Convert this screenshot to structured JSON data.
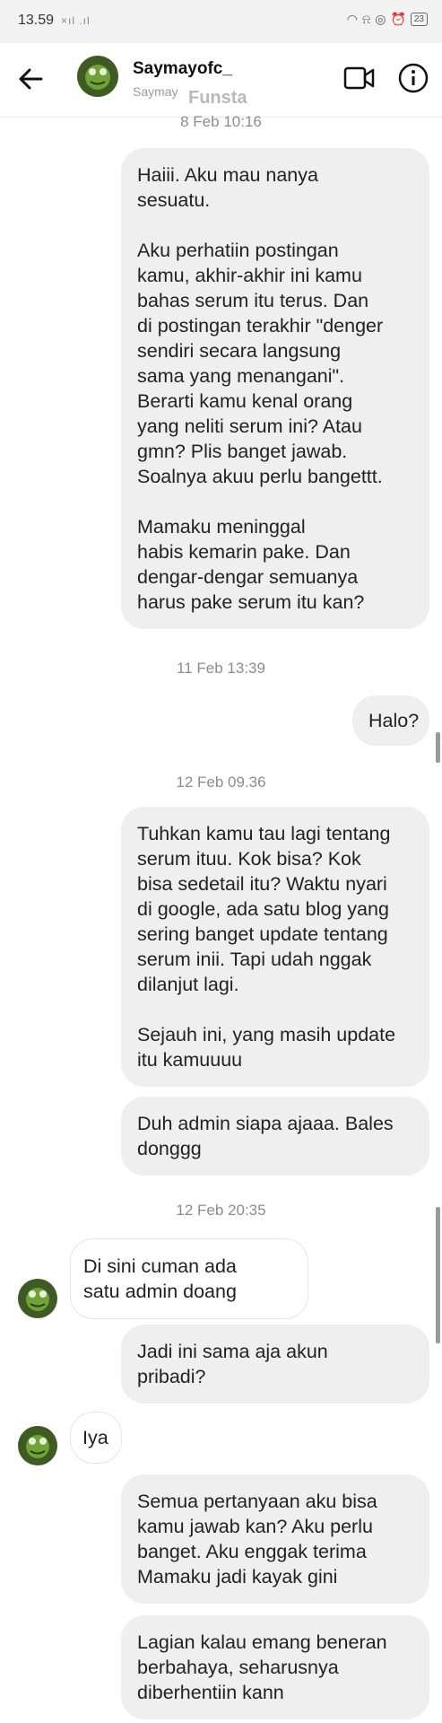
{
  "status_bar": {
    "time": "13.59",
    "left_icons": "×ıl .ıl",
    "battery": "23",
    "icons": [
      "wifi-icon",
      "mute-bell-icon",
      "data-saver-icon",
      "alarm-icon"
    ]
  },
  "header": {
    "name": "Saymayofc_",
    "subtitle": "Saymay",
    "subtitle_overlay": "Funsta",
    "icons": [
      "back-arrow-icon",
      "video-call-icon",
      "info-icon"
    ]
  },
  "chat": {
    "timestamps": [
      "8 Feb 10:16",
      "11 Feb 13:39",
      "12 Feb 09.36",
      "12 Feb 20:35"
    ],
    "messages": [
      {
        "dir": "out",
        "text": "Haiii. Aku mau nanya\nsesuatu.\n\nAku perhatiin postingan\nkamu, akhir-akhir ini kamu\nbahas serum itu terus. Dan\ndi postingan terakhir \"denger\nsendiri secara langsung\nsama yang menangani\".\nBerarti kamu kenal orang\nyang neliti serum ini? Atau\ngmn? Plis banget jawab.\nSoalnya akuu perlu bangettt.\n\nMamaku meninggal\nhabis kemarin pake. Dan\ndengar-dengar semuanya\nharus pake serum itu kan?"
      },
      {
        "dir": "out",
        "text": "Halo?"
      },
      {
        "dir": "out",
        "text": "Tuhkan kamu tau lagi tentang\nserum ituu. Kok bisa? Kok\nbisa sedetail itu? Waktu nyari\ndi google, ada satu blog yang\nsering banget update tentang\nserum inii. Tapi udah nggak\ndilanjut lagi.\n\nSejauh ini, yang masih update\nitu kamuuuu"
      },
      {
        "dir": "out",
        "text": "Duh admin siapa ajaaa. Bales\ndonggg"
      },
      {
        "dir": "in",
        "text": "Di sini cuman ada\nsatu admin doang"
      },
      {
        "dir": "out",
        "text": "Jadi ini sama aja akun\npribadi?"
      },
      {
        "dir": "in",
        "text": "Iya"
      },
      {
        "dir": "out",
        "text": "Semua pertanyaan aku bisa\nkamu jawab kan? Aku perlu\nbanget. Aku enggak terima\nMamaku jadi kayak gini"
      },
      {
        "dir": "out",
        "text": "Lagian kalau emang beneran\nberbahaya, seharusnya\ndiberhentiin kann"
      }
    ]
  },
  "colors": {
    "outgoing_bubble": "#efefef",
    "incoming_bubble_border": "#e6e6e6",
    "timestamp": "#8c8c8c",
    "avatar_green": "#5d8b2f"
  }
}
